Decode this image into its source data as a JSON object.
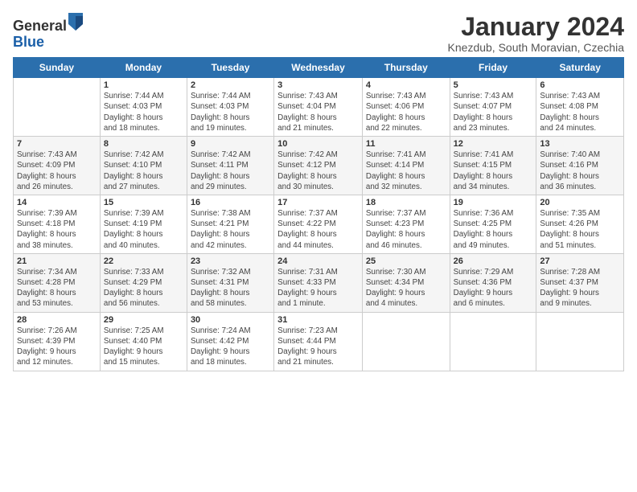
{
  "logo": {
    "general": "General",
    "blue": "Blue"
  },
  "title": "January 2024",
  "subtitle": "Knezdub, South Moravian, Czechia",
  "headers": [
    "Sunday",
    "Monday",
    "Tuesday",
    "Wednesday",
    "Thursday",
    "Friday",
    "Saturday"
  ],
  "weeks": [
    [
      {
        "day": "",
        "info": ""
      },
      {
        "day": "1",
        "info": "Sunrise: 7:44 AM\nSunset: 4:03 PM\nDaylight: 8 hours\nand 18 minutes."
      },
      {
        "day": "2",
        "info": "Sunrise: 7:44 AM\nSunset: 4:03 PM\nDaylight: 8 hours\nand 19 minutes."
      },
      {
        "day": "3",
        "info": "Sunrise: 7:43 AM\nSunset: 4:04 PM\nDaylight: 8 hours\nand 21 minutes."
      },
      {
        "day": "4",
        "info": "Sunrise: 7:43 AM\nSunset: 4:06 PM\nDaylight: 8 hours\nand 22 minutes."
      },
      {
        "day": "5",
        "info": "Sunrise: 7:43 AM\nSunset: 4:07 PM\nDaylight: 8 hours\nand 23 minutes."
      },
      {
        "day": "6",
        "info": "Sunrise: 7:43 AM\nSunset: 4:08 PM\nDaylight: 8 hours\nand 24 minutes."
      }
    ],
    [
      {
        "day": "7",
        "info": "Sunrise: 7:43 AM\nSunset: 4:09 PM\nDaylight: 8 hours\nand 26 minutes."
      },
      {
        "day": "8",
        "info": "Sunrise: 7:42 AM\nSunset: 4:10 PM\nDaylight: 8 hours\nand 27 minutes."
      },
      {
        "day": "9",
        "info": "Sunrise: 7:42 AM\nSunset: 4:11 PM\nDaylight: 8 hours\nand 29 minutes."
      },
      {
        "day": "10",
        "info": "Sunrise: 7:42 AM\nSunset: 4:12 PM\nDaylight: 8 hours\nand 30 minutes."
      },
      {
        "day": "11",
        "info": "Sunrise: 7:41 AM\nSunset: 4:14 PM\nDaylight: 8 hours\nand 32 minutes."
      },
      {
        "day": "12",
        "info": "Sunrise: 7:41 AM\nSunset: 4:15 PM\nDaylight: 8 hours\nand 34 minutes."
      },
      {
        "day": "13",
        "info": "Sunrise: 7:40 AM\nSunset: 4:16 PM\nDaylight: 8 hours\nand 36 minutes."
      }
    ],
    [
      {
        "day": "14",
        "info": "Sunrise: 7:39 AM\nSunset: 4:18 PM\nDaylight: 8 hours\nand 38 minutes."
      },
      {
        "day": "15",
        "info": "Sunrise: 7:39 AM\nSunset: 4:19 PM\nDaylight: 8 hours\nand 40 minutes."
      },
      {
        "day": "16",
        "info": "Sunrise: 7:38 AM\nSunset: 4:21 PM\nDaylight: 8 hours\nand 42 minutes."
      },
      {
        "day": "17",
        "info": "Sunrise: 7:37 AM\nSunset: 4:22 PM\nDaylight: 8 hours\nand 44 minutes."
      },
      {
        "day": "18",
        "info": "Sunrise: 7:37 AM\nSunset: 4:23 PM\nDaylight: 8 hours\nand 46 minutes."
      },
      {
        "day": "19",
        "info": "Sunrise: 7:36 AM\nSunset: 4:25 PM\nDaylight: 8 hours\nand 49 minutes."
      },
      {
        "day": "20",
        "info": "Sunrise: 7:35 AM\nSunset: 4:26 PM\nDaylight: 8 hours\nand 51 minutes."
      }
    ],
    [
      {
        "day": "21",
        "info": "Sunrise: 7:34 AM\nSunset: 4:28 PM\nDaylight: 8 hours\nand 53 minutes."
      },
      {
        "day": "22",
        "info": "Sunrise: 7:33 AM\nSunset: 4:29 PM\nDaylight: 8 hours\nand 56 minutes."
      },
      {
        "day": "23",
        "info": "Sunrise: 7:32 AM\nSunset: 4:31 PM\nDaylight: 8 hours\nand 58 minutes."
      },
      {
        "day": "24",
        "info": "Sunrise: 7:31 AM\nSunset: 4:33 PM\nDaylight: 9 hours\nand 1 minute."
      },
      {
        "day": "25",
        "info": "Sunrise: 7:30 AM\nSunset: 4:34 PM\nDaylight: 9 hours\nand 4 minutes."
      },
      {
        "day": "26",
        "info": "Sunrise: 7:29 AM\nSunset: 4:36 PM\nDaylight: 9 hours\nand 6 minutes."
      },
      {
        "day": "27",
        "info": "Sunrise: 7:28 AM\nSunset: 4:37 PM\nDaylight: 9 hours\nand 9 minutes."
      }
    ],
    [
      {
        "day": "28",
        "info": "Sunrise: 7:26 AM\nSunset: 4:39 PM\nDaylight: 9 hours\nand 12 minutes."
      },
      {
        "day": "29",
        "info": "Sunrise: 7:25 AM\nSunset: 4:40 PM\nDaylight: 9 hours\nand 15 minutes."
      },
      {
        "day": "30",
        "info": "Sunrise: 7:24 AM\nSunset: 4:42 PM\nDaylight: 9 hours\nand 18 minutes."
      },
      {
        "day": "31",
        "info": "Sunrise: 7:23 AM\nSunset: 4:44 PM\nDaylight: 9 hours\nand 21 minutes."
      },
      {
        "day": "",
        "info": ""
      },
      {
        "day": "",
        "info": ""
      },
      {
        "day": "",
        "info": ""
      }
    ]
  ]
}
